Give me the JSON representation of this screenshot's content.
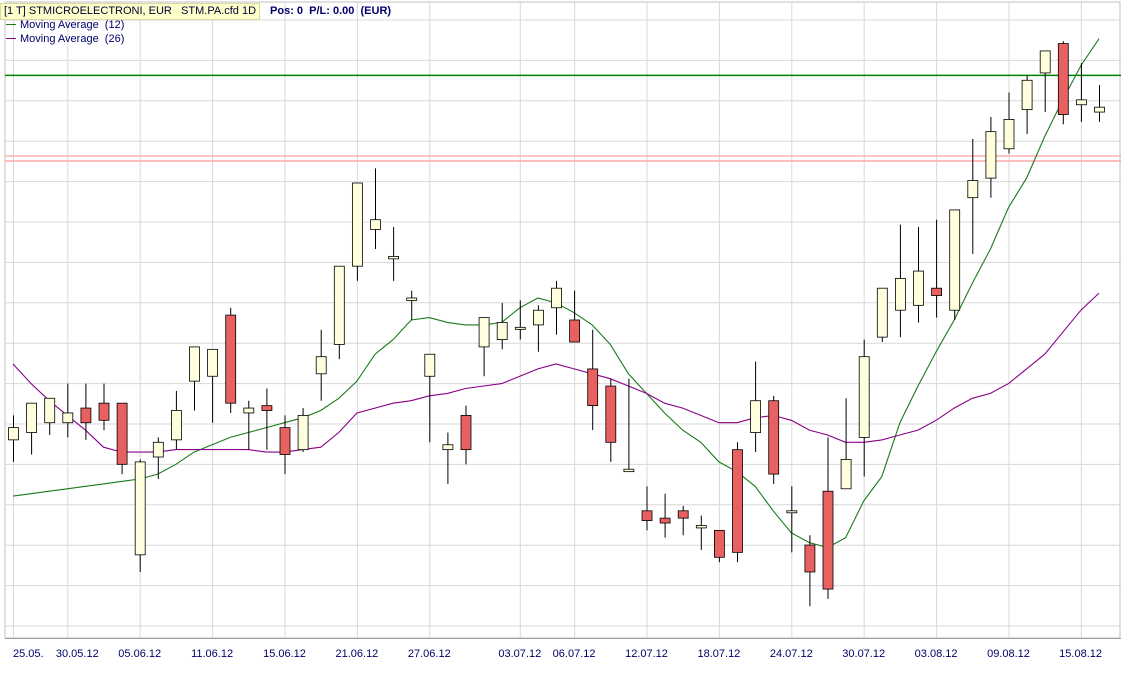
{
  "window": {
    "title": "[1 T] STMICROELECTRONI, EUR   STM.PA.cfd 1D",
    "position_text": "Pos: 0  P/L: 0.00  (EUR)"
  },
  "legend": [
    {
      "label": "Moving Average  (12)",
      "color": "#1a7a1a"
    },
    {
      "label": "Moving Average  (26)",
      "color": "#880088"
    }
  ],
  "colors": {
    "up_candle": "#ffffdd",
    "down_candle": "#e86060",
    "candle_outline": "#000000",
    "grid": "#d8d8d8",
    "axis_text": "#000066",
    "resistance_line": "#ffaaaa",
    "support_line": "#008000"
  },
  "chart_data": {
    "type": "candlestick",
    "title": "STMICROELECTRONI, EUR",
    "interval": "1D",
    "ylim": [
      -40,
      220
    ],
    "x_tick_labels": [
      {
        "label": "25.05.",
        "index": 0
      },
      {
        "label": "30.05.12",
        "index": 3
      },
      {
        "label": "05.06.12",
        "index": 7
      },
      {
        "label": "11.06.12",
        "index": 11
      },
      {
        "label": "15.06.12",
        "index": 15
      },
      {
        "label": "21.06.12",
        "index": 19
      },
      {
        "label": "27.06.12",
        "index": 23
      },
      {
        "label": "03.07.12",
        "index": 28
      },
      {
        "label": "06.07.12",
        "index": 31
      },
      {
        "label": "12.07.12",
        "index": 35
      },
      {
        "label": "18.07.12",
        "index": 39
      },
      {
        "label": "24.07.12",
        "index": 43
      },
      {
        "label": "30.07.12",
        "index": 47
      },
      {
        "label": "03.08.12",
        "index": 51
      },
      {
        "label": "09.08.12",
        "index": 55
      },
      {
        "label": "15.08.12",
        "index": 59
      }
    ],
    "candles": [
      {
        "o": 41,
        "h": 51,
        "l": 32,
        "c": 46
      },
      {
        "o": 44,
        "h": 55,
        "l": 35,
        "c": 56
      },
      {
        "o": 48,
        "h": 58,
        "l": 43,
        "c": 58
      },
      {
        "o": 48,
        "h": 64,
        "l": 42,
        "c": 52
      },
      {
        "o": 54,
        "h": 64,
        "l": 41,
        "c": 48
      },
      {
        "o": 56,
        "h": 64,
        "l": 45,
        "c": 49
      },
      {
        "o": 56,
        "h": 55,
        "l": 27,
        "c": 31
      },
      {
        "o": -6,
        "h": 33,
        "l": -13,
        "c": 32
      },
      {
        "o": 34,
        "h": 42,
        "l": 25,
        "c": 40
      },
      {
        "o": 41,
        "h": 61,
        "l": 37,
        "c": 53
      },
      {
        "o": 65,
        "h": 79,
        "l": 53,
        "c": 79
      },
      {
        "o": 67,
        "h": 78,
        "l": 48,
        "c": 78
      },
      {
        "o": 92,
        "h": 95,
        "l": 52,
        "c": 56
      },
      {
        "o": 52,
        "h": 57,
        "l": 37,
        "c": 54
      },
      {
        "o": 55,
        "h": 62,
        "l": 37,
        "c": 53
      },
      {
        "o": 46,
        "h": 51,
        "l": 27,
        "c": 35
      },
      {
        "o": 37,
        "h": 54,
        "l": 36,
        "c": 51
      },
      {
        "o": 68,
        "h": 86,
        "l": 57,
        "c": 75
      },
      {
        "o": 80,
        "h": 106,
        "l": 74,
        "c": 112
      },
      {
        "o": 112,
        "h": 122,
        "l": 106,
        "c": 146
      },
      {
        "o": 127,
        "h": 152,
        "l": 119,
        "c": 131
      },
      {
        "o": 115,
        "h": 128,
        "l": 106,
        "c": 116
      },
      {
        "o": 98,
        "h": 102,
        "l": 90,
        "c": 99
      },
      {
        "o": 67,
        "h": 76,
        "l": 40,
        "c": 76
      },
      {
        "o": 37,
        "h": 44,
        "l": 23,
        "c": 39
      },
      {
        "o": 51,
        "h": 55,
        "l": 31,
        "c": 37
      },
      {
        "o": 79,
        "h": 87,
        "l": 67,
        "c": 91
      },
      {
        "o": 82,
        "h": 97,
        "l": 78,
        "c": 89
      },
      {
        "o": 87,
        "h": 98,
        "l": 82,
        "c": 87
      },
      {
        "o": 88,
        "h": 96,
        "l": 77,
        "c": 94
      },
      {
        "o": 95,
        "h": 106,
        "l": 84,
        "c": 103
      },
      {
        "o": 90,
        "h": 102,
        "l": 81,
        "c": 81
      },
      {
        "o": 70,
        "h": 86,
        "l": 45,
        "c": 55
      },
      {
        "o": 63,
        "h": 66,
        "l": 32,
        "c": 40
      },
      {
        "o": 28,
        "h": 66,
        "l": 33,
        "c": 29
      },
      {
        "o": 12,
        "h": 22,
        "l": 4,
        "c": 8
      },
      {
        "o": 9,
        "h": 19,
        "l": 1,
        "c": 7
      },
      {
        "o": 12,
        "h": 14,
        "l": 2,
        "c": 9
      },
      {
        "o": 5,
        "h": 10,
        "l": -4,
        "c": 6
      },
      {
        "o": 4,
        "h": 3,
        "l": -9,
        "c": -7
      },
      {
        "o": 37,
        "h": 40,
        "l": -9,
        "c": -5
      },
      {
        "o": 44,
        "h": 73,
        "l": 36,
        "c": 57
      },
      {
        "o": 57,
        "h": 59,
        "l": 23,
        "c": 27
      },
      {
        "o": 12,
        "h": 22,
        "l": -5,
        "c": 12
      },
      {
        "o": -2,
        "h": 2,
        "l": -27,
        "c": -13
      },
      {
        "o": 20,
        "h": 42,
        "l": -24,
        "c": -20
      },
      {
        "o": 21,
        "h": 58,
        "l": 21,
        "c": 33
      },
      {
        "o": 42,
        "h": 82,
        "l": 26,
        "c": 75
      },
      {
        "o": 83,
        "h": 95,
        "l": 81,
        "c": 103
      },
      {
        "o": 94,
        "h": 129,
        "l": 83,
        "c": 107
      },
      {
        "o": 96,
        "h": 128,
        "l": 89,
        "c": 110
      },
      {
        "o": 103,
        "h": 131,
        "l": 91,
        "c": 100
      },
      {
        "o": 94,
        "h": 135,
        "l": 90,
        "c": 135
      },
      {
        "o": 140,
        "h": 164,
        "l": 117,
        "c": 147
      },
      {
        "o": 148,
        "h": 173,
        "l": 140,
        "c": 167
      },
      {
        "o": 160,
        "h": 183,
        "l": 158,
        "c": 172
      },
      {
        "o": 176,
        "h": 190,
        "l": 166,
        "c": 188
      },
      {
        "o": 191,
        "h": 198,
        "l": 175,
        "c": 200
      },
      {
        "o": 203,
        "h": 204,
        "l": 170,
        "c": 174
      },
      {
        "o": 178,
        "h": 195,
        "l": 171,
        "c": 180
      },
      {
        "o": 175,
        "h": 186,
        "l": 171,
        "c": 177
      }
    ],
    "series": [
      {
        "name": "Moving Average  (12)",
        "values": [
          18,
          19,
          20,
          21,
          22,
          23,
          24,
          25,
          27,
          31,
          36,
          39,
          42,
          44,
          46,
          48,
          50,
          53,
          58,
          65,
          76,
          82,
          90,
          91,
          89,
          88,
          88,
          89,
          95,
          99,
          97,
          93,
          88,
          80,
          68,
          60,
          52,
          45,
          40,
          32,
          28,
          22,
          12,
          3,
          -1,
          -3,
          1,
          16,
          26,
          48,
          63,
          77,
          90,
          105,
          119,
          136,
          148,
          165,
          180,
          194,
          205
        ]
      },
      {
        "name": "Moving Average  (26)",
        "values": [
          72,
          64,
          57,
          51,
          45,
          38,
          36,
          36,
          36,
          37,
          37,
          37,
          37,
          37,
          36,
          36,
          37,
          38,
          44,
          52,
          54,
          56,
          57,
          59,
          60,
          62,
          63,
          64,
          67,
          70,
          72,
          70,
          68,
          66,
          63,
          60,
          56,
          54,
          51,
          48,
          48,
          50,
          51,
          49,
          45,
          43,
          40,
          40,
          41,
          43,
          45,
          49,
          54,
          58,
          60,
          64,
          70,
          76,
          85,
          94,
          101
        ]
      }
    ],
    "horizontal_lines": [
      {
        "value": 190,
        "kind": "support"
      },
      {
        "value": 157,
        "kind": "resistance"
      },
      {
        "value": 155,
        "kind": "resistance"
      }
    ]
  }
}
